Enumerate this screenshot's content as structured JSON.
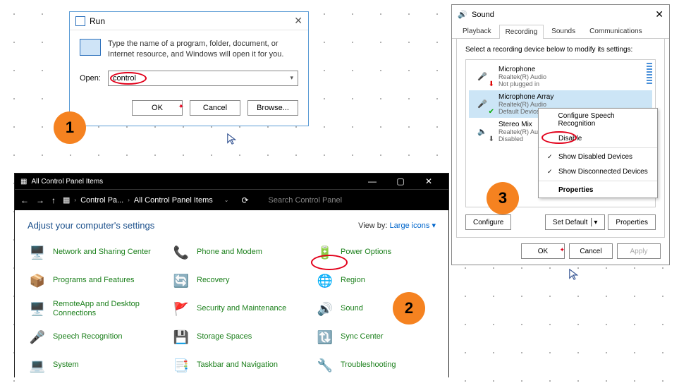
{
  "badges": {
    "one": "1",
    "two": "2",
    "three": "3"
  },
  "run": {
    "title": "Run",
    "message": "Type the name of a program, folder, document, or Internet resource, and Windows will open it for you.",
    "open_label": "Open:",
    "input_value": "control",
    "ok": "OK",
    "cancel": "Cancel",
    "browse": "Browse..."
  },
  "cp": {
    "window_title": "All Control Panel Items",
    "crumb1": "Control Pa...",
    "crumb2": "All Control Panel Items",
    "search_placeholder": "Search Control Panel",
    "adjust": "Adjust your computer's settings",
    "view_by_label": "View by:",
    "view_by_value": "Large icons ▾",
    "items": [
      {
        "label": "Network and Sharing Center",
        "icon": "🖥️"
      },
      {
        "label": "Phone and Modem",
        "icon": "📞"
      },
      {
        "label": "Power Options",
        "icon": "🔋"
      },
      {
        "label": "Programs and Features",
        "icon": "📦"
      },
      {
        "label": "Recovery",
        "icon": "🔄"
      },
      {
        "label": "Region",
        "icon": "🌐"
      },
      {
        "label": "RemoteApp and Desktop Connections",
        "icon": "🖥️"
      },
      {
        "label": "Security and Maintenance",
        "icon": "🚩"
      },
      {
        "label": "Sound",
        "icon": "🔊"
      },
      {
        "label": "Speech Recognition",
        "icon": "🎤"
      },
      {
        "label": "Storage Spaces",
        "icon": "💾"
      },
      {
        "label": "Sync Center",
        "icon": "🔃"
      },
      {
        "label": "System",
        "icon": "💻"
      },
      {
        "label": "Taskbar and Navigation",
        "icon": "📑"
      },
      {
        "label": "Troubleshooting",
        "icon": "🔧"
      }
    ]
  },
  "snd": {
    "title": "Sound",
    "tabs": {
      "playback": "Playback",
      "recording": "Recording",
      "sounds": "Sounds",
      "comm": "Communications"
    },
    "instruction": "Select a recording device below to modify its settings:",
    "devices": [
      {
        "name": "Microphone",
        "sub1": "Realtek(R) Audio",
        "sub2": "Not plugged in"
      },
      {
        "name": "Microphone Array",
        "sub1": "Realtek(R) Audio",
        "sub2": "Default Device"
      },
      {
        "name": "Stereo Mix",
        "sub1": "Realtek(R) Audio",
        "sub2": "Disabled"
      }
    ],
    "ctx": {
      "configure": "Configure Speech Recognition",
      "disable": "Disable",
      "show_disabled": "Show Disabled Devices",
      "show_disconnected": "Show Disconnected Devices",
      "properties": "Properties"
    },
    "buttons": {
      "configure": "Configure",
      "set_default": "Set Default",
      "properties": "Properties",
      "ok": "OK",
      "cancel": "Cancel",
      "apply": "Apply"
    }
  }
}
